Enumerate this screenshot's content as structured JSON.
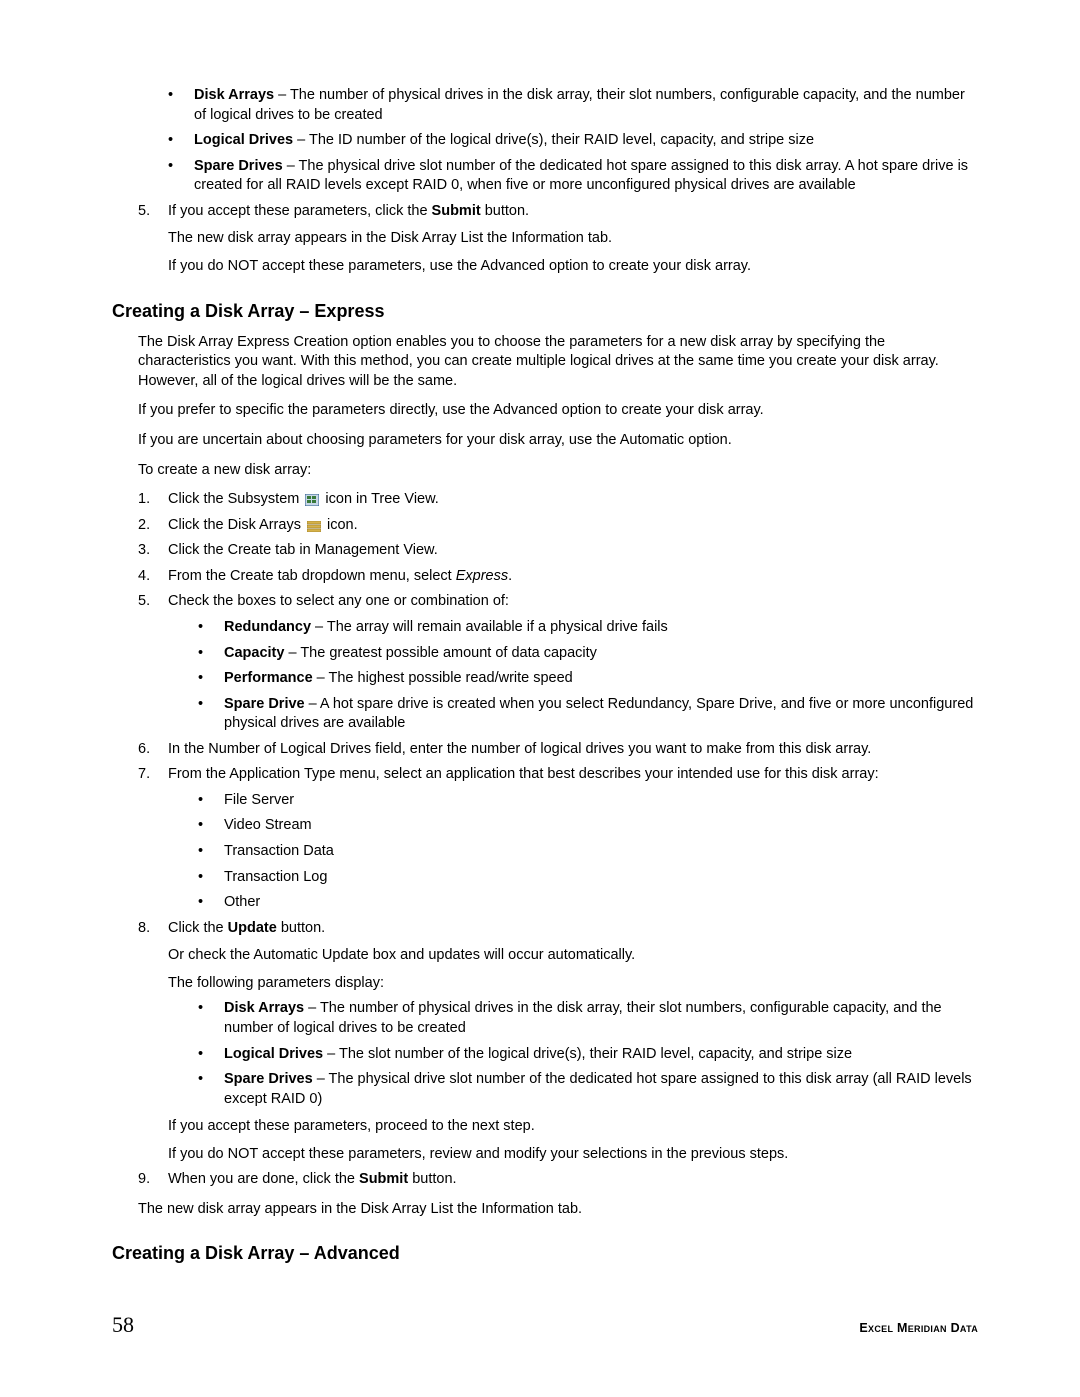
{
  "top_list": {
    "disk_arrays_label": "Disk Arrays",
    "disk_arrays_text": " – The number of physical drives in the disk array, their slot numbers, configurable capacity, and the number of logical drives to be created",
    "logical_drives_label": "Logical Drives",
    "logical_drives_text": " – The ID number of the logical drive(s), their RAID level, capacity, and stripe size",
    "spare_drives_label": "Spare Drives",
    "spare_drives_text": " – The physical drive slot number of the dedicated hot spare assigned to this disk array. A hot spare drive is created for all RAID levels except RAID 0, when five or more unconfigured physical drives are available"
  },
  "step5": {
    "num": "5.",
    "line1_a": "If you accept these parameters, click the ",
    "line1_b": "Submit",
    "line1_c": " button.",
    "line2": "The new disk array appears in the Disk Array List the Information tab.",
    "line3": "If you do NOT accept these parameters, use the Advanced option to create your disk array."
  },
  "express": {
    "heading": "Creating a Disk Array – Express",
    "p1": "The Disk Array Express Creation option enables you to choose the parameters for a new disk array by specifying the characteristics you want. With this method, you can create multiple logical drives at the same time you create your disk array. However, all of the logical drives will be the same.",
    "p2": "If you prefer to specific the parameters directly, use the Advanced option to create your disk array.",
    "p3": "If you are uncertain about choosing parameters for your disk array, use the Automatic option.",
    "p4": "To create a new disk array:",
    "steps": {
      "s1_num": "1.",
      "s1_a": "Click the Subsystem ",
      "s1_b": " icon in Tree View.",
      "s2_num": "2.",
      "s2_a": "Click the Disk Arrays ",
      "s2_b": " icon.",
      "s3_num": "3.",
      "s3": "Click the Create tab in Management View.",
      "s4_num": "4.",
      "s4_a": "From the Create tab dropdown menu, select ",
      "s4_b": "Express",
      "s4_c": ".",
      "s5_num": "5.",
      "s5": "Check the boxes to select any one or combination of:",
      "s5_items": {
        "redundancy_l": "Redundancy",
        "redundancy_t": " – The array will remain available if a physical drive fails",
        "capacity_l": "Capacity",
        "capacity_t": " – The greatest possible amount of data capacity",
        "performance_l": "Performance",
        "performance_t": " – The highest possible read/write speed",
        "spare_l": "Spare Drive",
        "spare_t": " – A hot spare drive is created when you select Redundancy, Spare Drive, and five or more unconfigured physical drives are available"
      },
      "s6_num": "6.",
      "s6": "In the Number of Logical Drives field, enter the number of logical drives you want to make from this disk array.",
      "s7_num": "7.",
      "s7": "From the Application Type menu, select an application that best describes your intended use for this disk array:",
      "s7_items": {
        "a": "File Server",
        "b": "Video Stream",
        "c": "Transaction Data",
        "d": "Transaction Log",
        "e": "Other"
      },
      "s8_num": "8.",
      "s8_a": "Click the ",
      "s8_b": "Update",
      "s8_c": " button.",
      "s8_p1": "Or check the Automatic Update box and updates will occur automatically.",
      "s8_p2": "The following parameters display:",
      "s8_items": {
        "da_l": "Disk Arrays",
        "da_t": " – The number of physical drives in the disk array, their slot numbers, configurable capacity, and the number of logical drives to be created",
        "ld_l": "Logical Drives",
        "ld_t": " – The slot number of the logical drive(s), their RAID level, capacity, and stripe size",
        "sd_l": "Spare Drives",
        "sd_t": " – The physical drive slot number of the dedicated hot spare assigned to this disk array (all RAID levels except RAID 0)"
      },
      "s8_p3": "If you accept these parameters, proceed to the next step.",
      "s8_p4": "If you do NOT accept these parameters, review and modify your selections in the previous steps.",
      "s9_num": "9.",
      "s9_a": "When you are done, click the ",
      "s9_b": "Submit",
      "s9_c": " button."
    },
    "closing": "The new disk array appears in the Disk Array List the Information tab."
  },
  "advanced": {
    "heading": "Creating a Disk Array – Advanced"
  },
  "footer": {
    "page": "58",
    "brand": "Excel Meridian Data"
  }
}
